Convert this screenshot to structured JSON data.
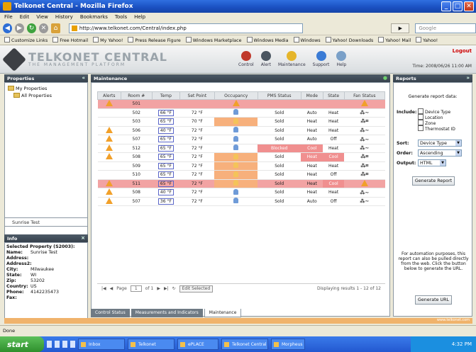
{
  "window": {
    "title": "Telkonet Central - Mozilla Firefox"
  },
  "menu": [
    "File",
    "Edit",
    "View",
    "History",
    "Bookmarks",
    "Tools",
    "Help"
  ],
  "nav": {
    "url": "http://www.telkonet.com/Central/index.php",
    "search_placeholder": "Google"
  },
  "bookmarks": [
    "Customize Links",
    "Free Hotmail",
    "My Yahoo!",
    "Press Release Figure",
    "Windows Marketplace",
    "Windows Media",
    "Windows",
    "Yahoo! Downloads",
    "Yahoo! Mail",
    "Yahoo!"
  ],
  "header": {
    "logo": "TELKONET CENTRAL",
    "logo_sub": "THE MANAGEMENT PLATFORM",
    "nav": [
      "Control",
      "Alert",
      "Maintenance",
      "Support",
      "Help"
    ],
    "logout": "Logout",
    "time": "Time: 2008/06/26 11:00 AM"
  },
  "left": {
    "panel_title": "Properties",
    "tree": [
      "My Properties",
      "All Properties"
    ],
    "search_text": "Sunrise Test",
    "info_title": "Info",
    "info_heading": "Selected Property (S2003):",
    "info": [
      {
        "k": "Name:",
        "v": "Sunrise Test"
      },
      {
        "k": "Address:",
        "v": ""
      },
      {
        "k": "Address2:",
        "v": ""
      },
      {
        "k": "City:",
        "v": "Milwaukee"
      },
      {
        "k": "State:",
        "v": "WI"
      },
      {
        "k": "Zip:",
        "v": "53202"
      },
      {
        "k": "Country:",
        "v": "US"
      },
      {
        "k": "Phone:",
        "v": "4142235473"
      },
      {
        "k": "Fax:",
        "v": ""
      }
    ]
  },
  "center": {
    "panel_title": "Maintenance",
    "columns": [
      "Alerts",
      "Room #",
      "Temp",
      "Set Point",
      "Occupancy",
      "PMS Status",
      "Mode",
      "State",
      "Fan Status"
    ],
    "rows": [
      {
        "alert": true,
        "room": "501",
        "temp": "",
        "set": "",
        "occ": "warn",
        "pms": "",
        "mode": "",
        "state": "",
        "fan": "warn",
        "red": true
      },
      {
        "alert": false,
        "room": "502",
        "temp": "66 °F",
        "set": "72 °F",
        "occ": "person",
        "pms": "Sold",
        "mode": "Auto",
        "state": "Heat",
        "fan": "Fan~",
        "red": false
      },
      {
        "alert": false,
        "room": "503",
        "temp": "65 °F",
        "set": "70 °F",
        "occ": "orange",
        "pms": "Sold",
        "mode": "Heat",
        "state": "Heat",
        "fan": "Fan",
        "red": false
      },
      {
        "alert": true,
        "room": "506",
        "temp": "40 °F",
        "set": "72 °F",
        "occ": "person",
        "pms": "Sold",
        "mode": "Heat",
        "state": "Heat",
        "fan": "Fan~",
        "red": false
      },
      {
        "alert": true,
        "room": "507",
        "temp": "65 °F",
        "set": "72 °F",
        "occ": "person",
        "pms": "Sold",
        "mode": "Auto",
        "state": "Off",
        "fan": "Fan~",
        "red": false
      },
      {
        "alert": true,
        "room": "512",
        "temp": "65 °F",
        "set": "72 °F",
        "occ": "person",
        "pms": "Blocked",
        "mode": "Cool",
        "state": "Heat",
        "fan": "Fan~",
        "red": false,
        "pmsred": true
      },
      {
        "alert": true,
        "room": "508",
        "temp": "65 °F",
        "set": "72 °F",
        "occ": "orange",
        "pms": "Sold",
        "mode": "Heat",
        "state": "Cool",
        "fan": "Fan",
        "red": false
      },
      {
        "alert": false,
        "room": "509",
        "temp": "65 °F",
        "set": "72 °F",
        "occ": "orange",
        "pms": "Sold",
        "mode": "Heat",
        "state": "Heat",
        "fan": "Fan",
        "red": false
      },
      {
        "alert": false,
        "room": "510",
        "temp": "65 °F",
        "set": "72 °F",
        "occ": "orange",
        "pms": "Sold",
        "mode": "Heat",
        "state": "Off",
        "fan": "Fan",
        "red": false
      },
      {
        "alert": true,
        "room": "511",
        "temp": "65 °F",
        "set": "72 °F",
        "occ": "orange",
        "pms": "Sold",
        "mode": "Heat",
        "state": "Cool",
        "fan": "warn",
        "red": true
      },
      {
        "alert": true,
        "room": "508",
        "temp": "40 °F",
        "set": "72 °F",
        "occ": "person",
        "pms": "Sold",
        "mode": "Heat",
        "state": "Heat",
        "fan": "Fan~",
        "red": false
      },
      {
        "alert": true,
        "room": "507",
        "temp": "36 °F",
        "set": "72 °F",
        "occ": "person",
        "pms": "Sold",
        "mode": "Auto",
        "state": "Off",
        "fan": "Fan~",
        "red": false
      }
    ],
    "pager": {
      "page": "Page",
      "page_num": "1",
      "of": "of 1",
      "edit": "Edit Selected",
      "display": "Displaying results 1 - 12 of 12"
    },
    "tabs": [
      "Control Status",
      "Measurements and Indicators",
      "Maintenance"
    ]
  },
  "right": {
    "panel_title": "Reports",
    "title": "Generate report data:",
    "include_label": "Include:",
    "include": [
      "Device Type",
      "Location",
      "Zone",
      "Thermostat ID"
    ],
    "sort_label": "Sort:",
    "sort_value": "Device Type",
    "order_label": "Order:",
    "order_value": "Ascending",
    "output_label": "Output:",
    "output_value": "HTML",
    "generate": "Generate Report",
    "note": "For automation purposes, this report can also be pulled directly from the web. Click the button below to generate the URL.",
    "generate_url": "Generate URL"
  },
  "footer": {
    "brand": "www.telkonet.com",
    "status": "Done"
  },
  "taskbar": {
    "start": "start",
    "items": [
      "Inbox",
      "Telkonet",
      "ePLACE",
      "Telkonet Central",
      "Morpheus"
    ],
    "clock": "4:32 PM"
  }
}
